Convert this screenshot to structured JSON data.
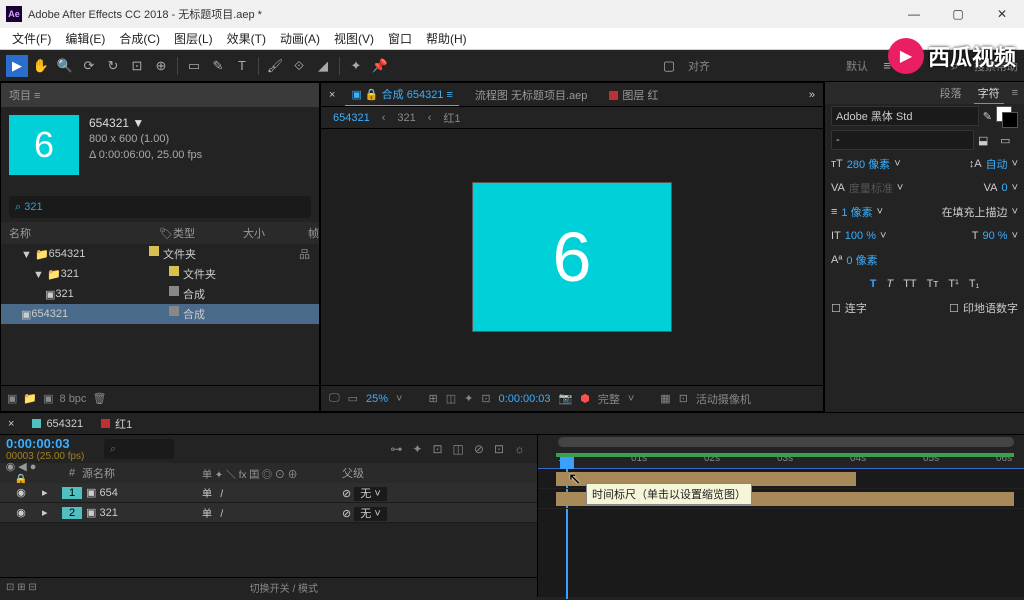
{
  "titlebar": {
    "app_icon": "Ae",
    "title": "Adobe After Effects CC 2018 - 无标题项目.aep *"
  },
  "menubar": [
    "文件(F)",
    "编辑(E)",
    "合成(C)",
    "图层(L)",
    "效果(T)",
    "动画(A)",
    "视图(V)",
    "窗口",
    "帮助(H)"
  ],
  "toolbar": {
    "align": "对齐",
    "default": "默认",
    "search": "搜索帮助"
  },
  "project": {
    "header": "项目 ≡",
    "thumb_text": "6",
    "name": "654321 ▼",
    "dims": "800 x 600 (1.00)",
    "duration": "Δ 0:00:06:00, 25.00 fps",
    "search_icon": "⌕",
    "search_value": "321",
    "cols": {
      "name": "名称",
      "type": "类型",
      "size": "大小",
      "frame": "帧"
    },
    "rows": [
      {
        "indent": 1,
        "expand": "▼",
        "icon": "folder",
        "name": "654321",
        "type": "文件夹"
      },
      {
        "indent": 2,
        "expand": "▼",
        "icon": "folder",
        "name": "321",
        "type": "文件夹"
      },
      {
        "indent": 3,
        "expand": "",
        "icon": "comp",
        "name": "321",
        "type": "合成"
      },
      {
        "indent": 1,
        "expand": "",
        "icon": "comp",
        "name": "654321",
        "type": "合成",
        "sel": true
      }
    ],
    "footer_bpc": "8 bpc"
  },
  "composition": {
    "tabs": {
      "lock": "🔒",
      "comp_label": "合成",
      "comp_name": "654321",
      "flowchart": "流程图 无标题项目.aep",
      "layer": "图层 红",
      "more": "»"
    },
    "crumbs": [
      "654321",
      "‹",
      "321",
      "‹",
      "红1"
    ],
    "canvas_text": "6",
    "footer": {
      "zoom": "25%",
      "time": "0:00:00:03",
      "res": "完整",
      "cam": "活动摄像机"
    }
  },
  "char_panel": {
    "tabs": {
      "para": "段落",
      "char": "字符"
    },
    "font": "Adobe 黑体 Std",
    "style": "-",
    "size": "280 像素",
    "leading": "自动",
    "kerning": "",
    "tracking_label": "VA",
    "tracking": "0",
    "stroke": "1 像素",
    "stroke_pos": "在填充上描边",
    "vscale": "100 %",
    "hscale": "90 %",
    "baseline": "0 像素",
    "faux": [
      "T",
      "T",
      "TT",
      "Tт",
      "T¹",
      "T₁"
    ],
    "opt1": "连字",
    "opt2": "印地语数字"
  },
  "timeline": {
    "tabs": [
      {
        "sw": "cyan",
        "name": "654321"
      },
      {
        "sw": "red",
        "name": "红1"
      }
    ],
    "timecode": "0:00:00:03",
    "frame": "00003 (25.00 fps)",
    "search": "⌕",
    "cols": {
      "num": "#",
      "name": "源名称",
      "switches": "单 ✦ ＼ fx 囯 ◎ ⊙ ⊕",
      "parent": "父级"
    },
    "layers": [
      {
        "num": "1",
        "name": "654",
        "switch": "单",
        "parent": "无"
      },
      {
        "num": "2",
        "name": "321",
        "switch": "单",
        "parent": "无"
      }
    ],
    "footer_mode": "切换开关 / 模式",
    "ruler": [
      "0s",
      "01s",
      "02s",
      "03s",
      "04s",
      "05s",
      "06s"
    ],
    "tooltip": "时间标尺（单击以设置缩览图）"
  },
  "watermark": {
    "icon": "▶",
    "text": "西瓜视频"
  }
}
